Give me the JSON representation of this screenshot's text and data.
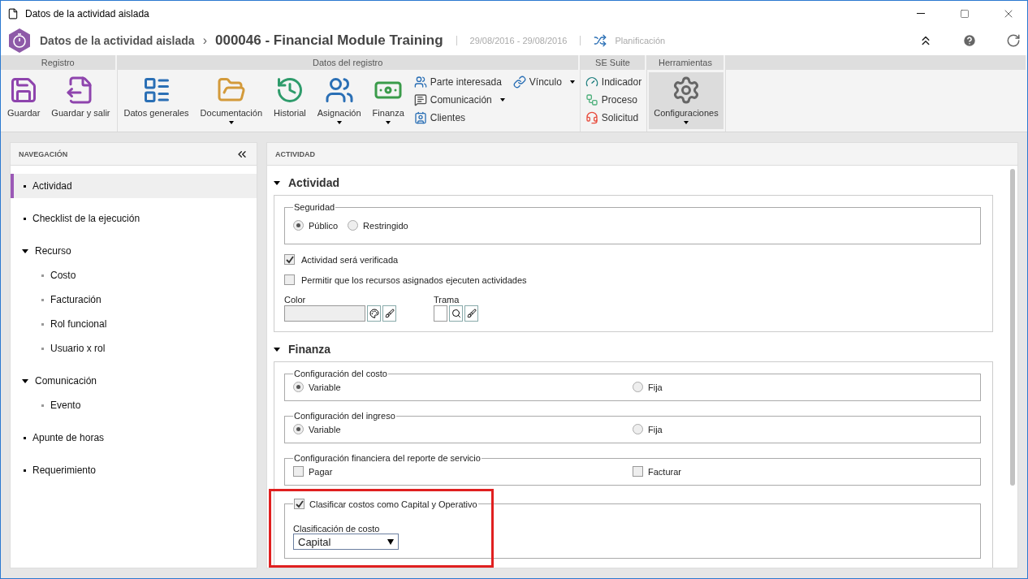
{
  "window": {
    "title": "Datos de la actividad aislada"
  },
  "header": {
    "breadcrumb": "Datos de la actividad aislada",
    "separator": "›",
    "title": "000046 - Financial Module Training",
    "dates": "29/08/2016 - 29/08/2016",
    "status": "Planificación"
  },
  "ribbon": [
    {
      "label": "Registro",
      "items": [
        {
          "kind": "large",
          "label": "Guardar",
          "dropdown": false,
          "selected": false
        },
        {
          "kind": "large",
          "label": "Guardar y salir",
          "dropdown": false,
          "selected": false
        }
      ]
    },
    {
      "label": "Datos del registro",
      "items": [
        {
          "kind": "large",
          "label": "Datos generales",
          "dropdown": false,
          "selected": false
        },
        {
          "kind": "large",
          "label": "Documentación",
          "dropdown": true,
          "selected": false
        },
        {
          "kind": "large",
          "label": "Historial",
          "dropdown": false,
          "selected": false
        },
        {
          "kind": "large",
          "label": "Asignación",
          "dropdown": true,
          "selected": false
        },
        {
          "kind": "large",
          "label": "Finanza",
          "dropdown": true,
          "selected": false
        },
        {
          "kind": "small",
          "label": "Parte interesada",
          "dropdown": false,
          "selected": false
        },
        {
          "kind": "small",
          "label": "Comunicación",
          "dropdown": true,
          "selected": false
        },
        {
          "kind": "small",
          "label": "Clientes",
          "dropdown": false,
          "selected": false
        },
        {
          "kind": "small",
          "label": "Vínculo",
          "dropdown": true,
          "selected": false
        }
      ]
    },
    {
      "label": "SE Suite",
      "items": [
        {
          "kind": "small",
          "label": "Indicador",
          "dropdown": false,
          "selected": false
        },
        {
          "kind": "small",
          "label": "Proceso",
          "dropdown": false,
          "selected": false
        },
        {
          "kind": "small",
          "label": "Solicitud",
          "dropdown": false,
          "selected": false
        }
      ]
    },
    {
      "label": "Herramientas",
      "items": [
        {
          "kind": "large",
          "label": "Configuraciones",
          "dropdown": true,
          "selected": true
        }
      ]
    }
  ],
  "navigation": {
    "title": "NAVEGACIÓN",
    "items": [
      {
        "label": "Actividad",
        "selected": true
      },
      {
        "label": "Checklist de la ejecución",
        "selected": false
      },
      {
        "label": "Recurso",
        "selected": false,
        "expanded": true,
        "children": [
          {
            "label": "Costo",
            "selected": false
          },
          {
            "label": "Facturación",
            "selected": false
          },
          {
            "label": "Rol funcional",
            "selected": false
          },
          {
            "label": "Usuario x rol",
            "selected": false
          }
        ]
      },
      {
        "label": "Comunicación",
        "selected": false,
        "expanded": true,
        "children": [
          {
            "label": "Evento",
            "selected": false
          }
        ]
      },
      {
        "label": "Apunte de horas",
        "selected": false
      },
      {
        "label": "Requerimiento",
        "selected": false
      }
    ]
  },
  "panel": {
    "title": "ACTIVIDAD",
    "sections": [
      {
        "title": "Actividad",
        "expanded": true,
        "blocks": [
          {
            "kind": "radio",
            "legend": "Seguridad",
            "options": [
              {
                "label": "Público",
                "selected": true
              },
              {
                "label": "Restringido",
                "selected": false
              }
            ]
          },
          {
            "kind": "check",
            "label": "Actividad será verificada",
            "checked": true
          },
          {
            "kind": "check",
            "label": "Permitir que los recursos asignados ejecuten actividades",
            "checked": false
          },
          {
            "kind": "pickers",
            "color_label": "Color",
            "pattern_label": "Trama"
          }
        ]
      },
      {
        "title": "Finanza",
        "expanded": true,
        "blocks": [
          {
            "kind": "radiowide",
            "legend": "Configuración del costo",
            "options": [
              {
                "label": "Variable",
                "selected": true
              },
              {
                "label": "Fija",
                "selected": false
              }
            ]
          },
          {
            "kind": "radiowide",
            "legend": "Configuración del ingreso",
            "options": [
              {
                "label": "Variable",
                "selected": true
              },
              {
                "label": "Fija",
                "selected": false
              }
            ]
          },
          {
            "kind": "checks",
            "legend": "Configuración financiera del reporte de servicio",
            "options": [
              {
                "label": "Pagar",
                "checked": false
              },
              {
                "label": "Facturar",
                "checked": false
              }
            ]
          },
          {
            "kind": "checklegend",
            "legend": "Clasificar costos como Capital y Operativo",
            "checked": true,
            "highlighted": true,
            "field_label": "Clasificación de costo",
            "value": "Capital"
          }
        ]
      }
    ]
  }
}
